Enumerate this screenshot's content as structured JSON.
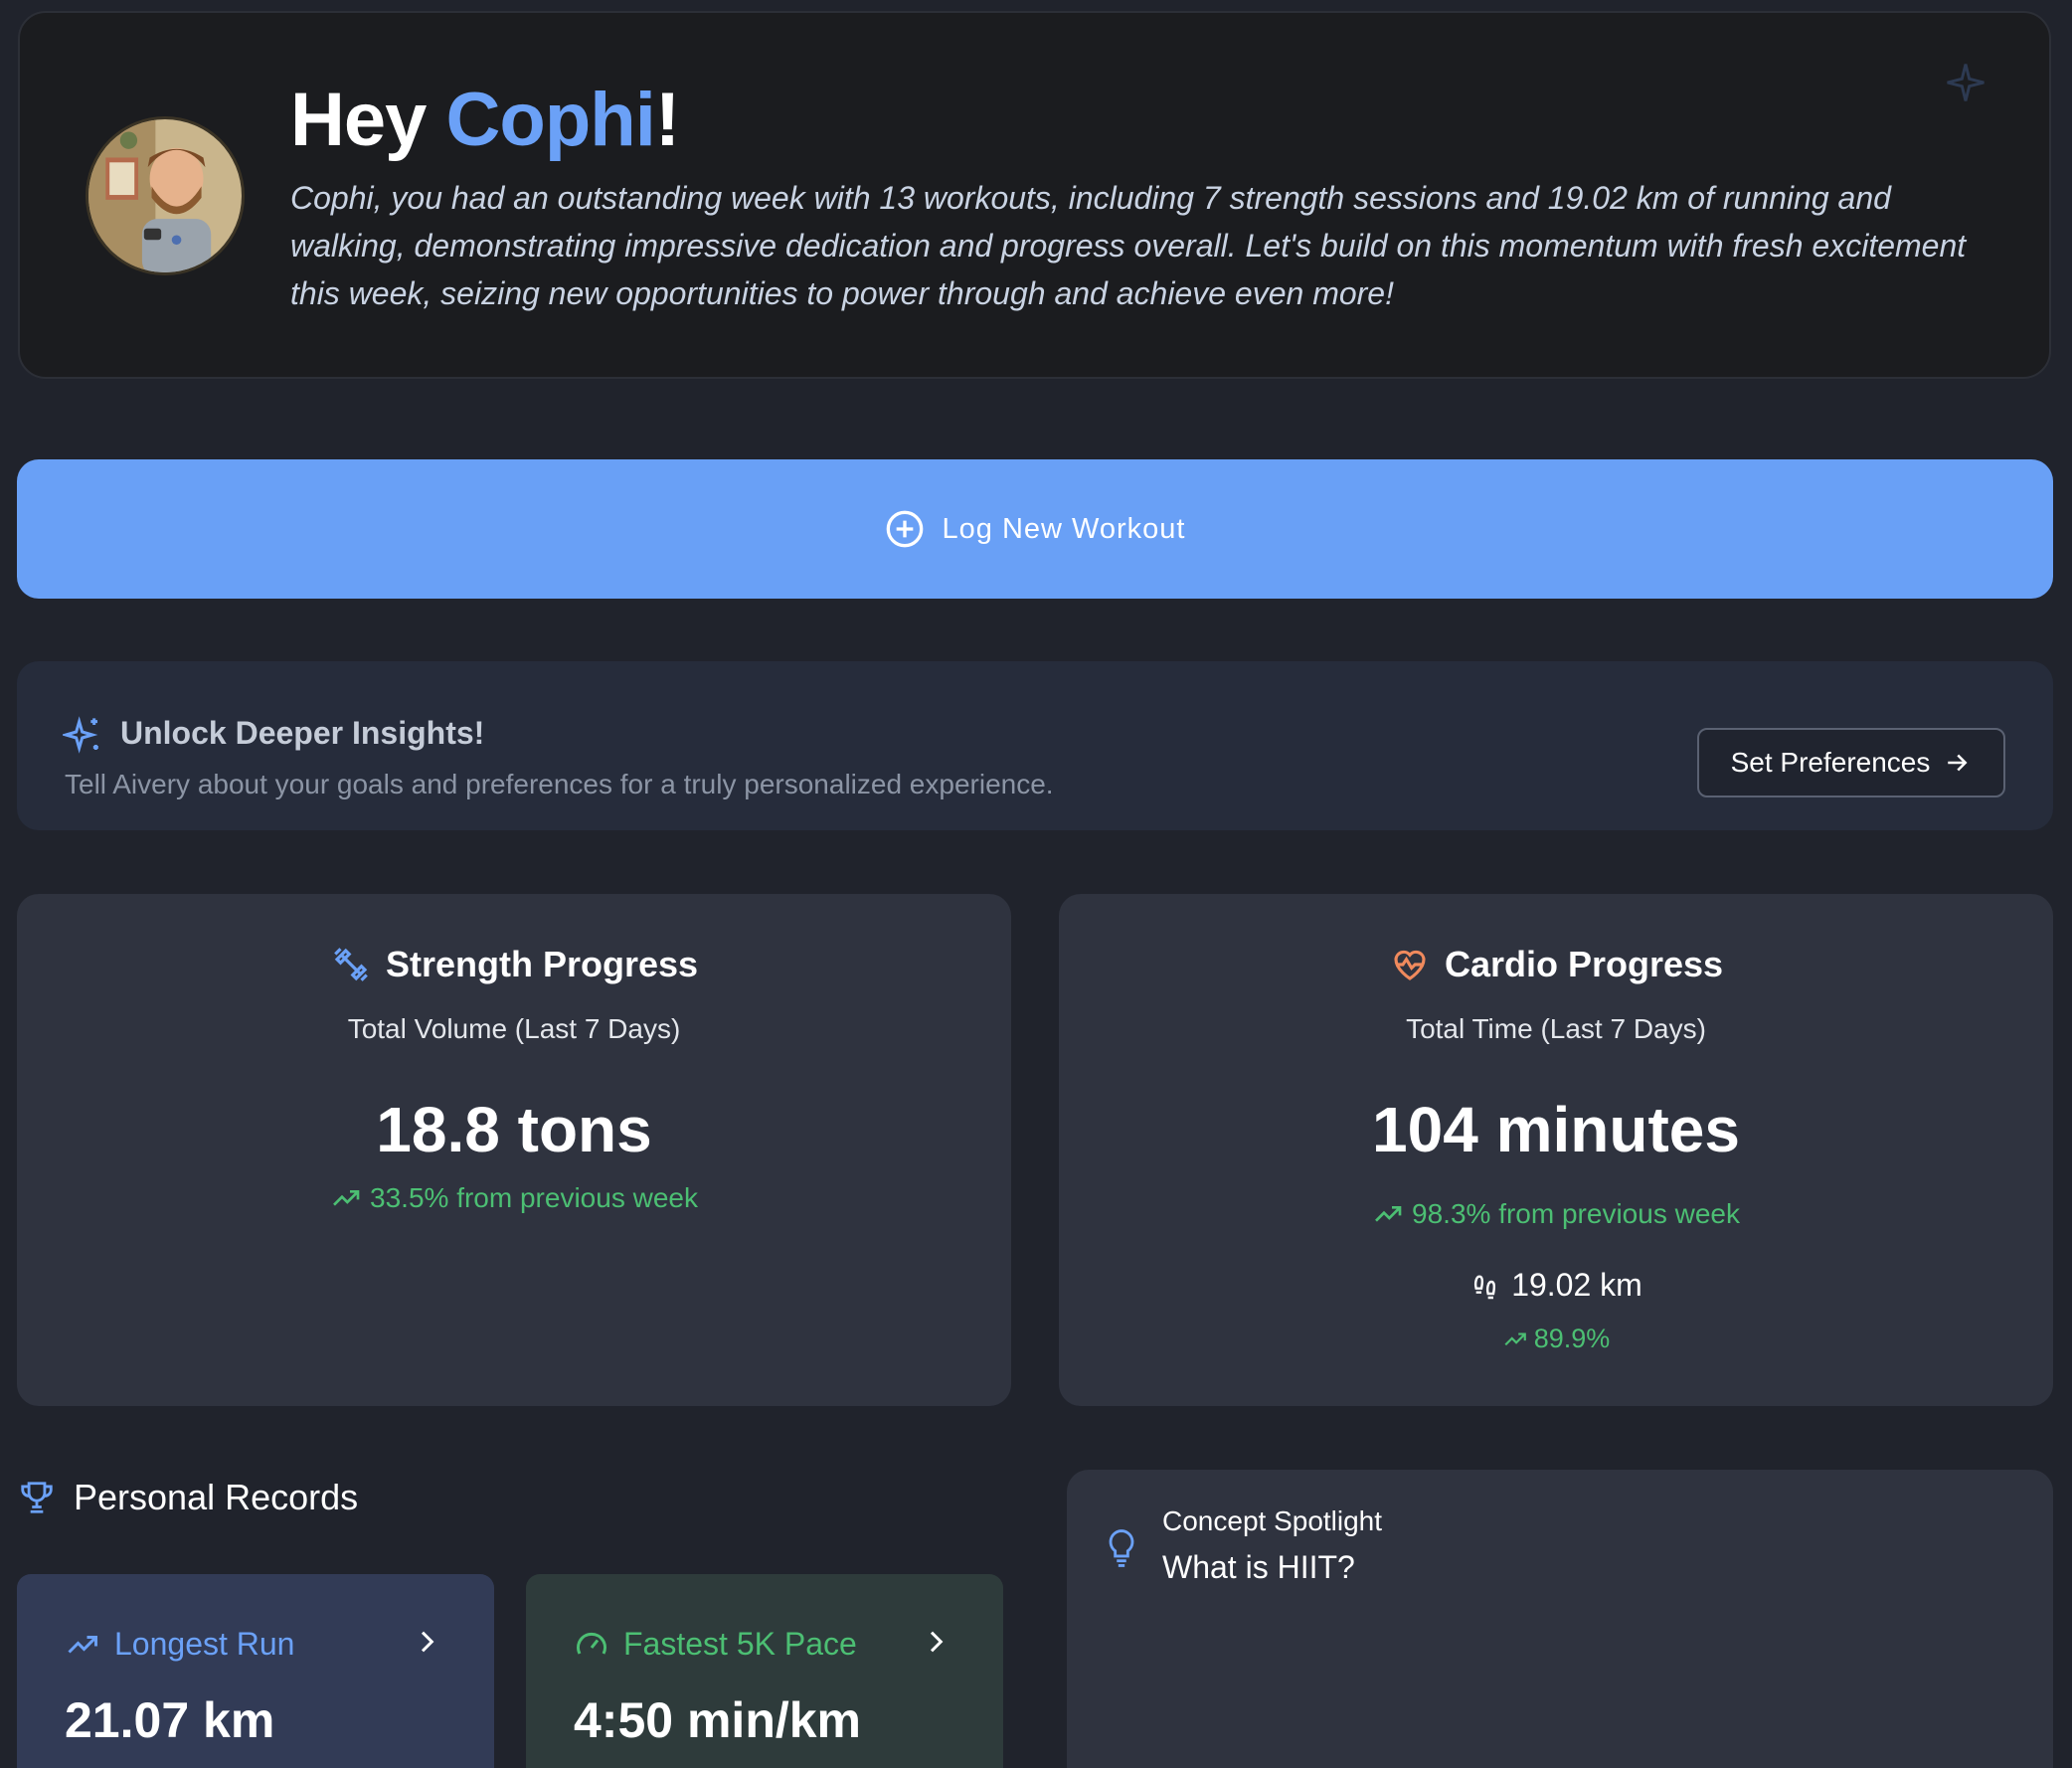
{
  "hero": {
    "greeting_prefix": "Hey ",
    "name": "Cophi",
    "greeting_suffix": "!",
    "summary": "Cophi, you had an outstanding week with 13 workouts, including 7 strength sessions and 19.02 km of running and walking, demonstrating impressive dedication and progress overall. Let's build on this momentum with fresh excitement this week, seizing new opportunities to power through and achieve even more!",
    "avatar_icon": "user-avatar-illustration",
    "corner_icon": "sparkle-icon"
  },
  "log_button": {
    "label": "Log New Workout",
    "icon": "plus-circle-icon"
  },
  "insights": {
    "icon": "sparkles-icon",
    "title": "Unlock Deeper Insights!",
    "subtitle": "Tell Aivery about your goals and preferences for a truly personalized experience.",
    "button_label": "Set Preferences",
    "button_icon": "arrow-right-icon"
  },
  "strength": {
    "icon": "dumbbell-icon",
    "title": "Strength Progress",
    "label": "Total Volume (Last 7 Days)",
    "value": "18.8 tons",
    "trend": "33.5% from previous week"
  },
  "cardio": {
    "icon": "heart-pulse-icon",
    "title": "Cardio Progress",
    "label": "Total Time (Last 7 Days)",
    "value": "104 minutes",
    "trend": "98.3% from previous week",
    "distance_icon": "footprints-icon",
    "distance": "19.02 km",
    "distance_trend": "89.9%"
  },
  "records": {
    "icon": "trophy-icon",
    "title": "Personal Records",
    "items": [
      {
        "label": "Longest Run",
        "value": "21.07 km",
        "icon": "trending-up-icon"
      },
      {
        "label": "Fastest 5K Pace",
        "value": "4:50 min/km",
        "icon": "gauge-icon"
      }
    ]
  },
  "concept": {
    "icon": "lightbulb-icon",
    "kicker": "Concept Spotlight",
    "title": "What is HIIT?"
  },
  "colors": {
    "background": "#20232c",
    "accent_blue": "#6ba1f7",
    "trend_green": "#4cbf73",
    "cardio_orange": "#f08a5d"
  }
}
